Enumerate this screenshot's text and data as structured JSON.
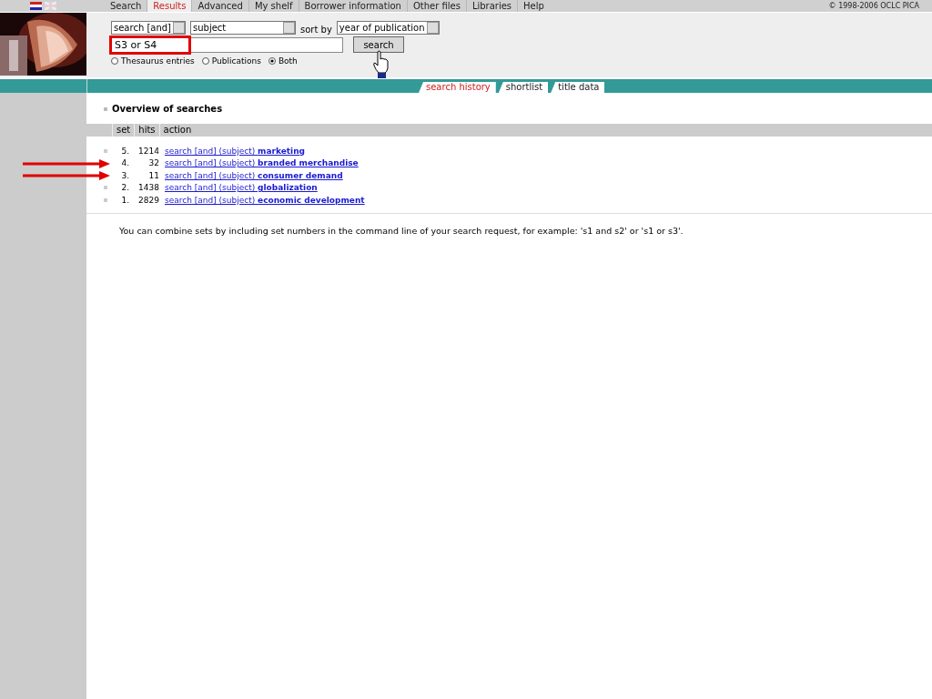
{
  "nav": {
    "items": [
      {
        "label": "Search",
        "selected": false
      },
      {
        "label": "Results",
        "selected": true
      },
      {
        "label": "Advanced",
        "selected": false
      },
      {
        "label": "My shelf",
        "selected": false
      },
      {
        "label": "Borrower information",
        "selected": false
      },
      {
        "label": "Other files",
        "selected": false
      },
      {
        "label": "Libraries",
        "selected": false
      },
      {
        "label": "Help",
        "selected": false
      }
    ],
    "copyright": "© 1998-2006 OCLC PICA"
  },
  "search_form": {
    "operator": "search [and]",
    "index": "subject",
    "sort_label": "sort by",
    "sort": "year of publication",
    "query": "S3 or S4",
    "query_highlighted": true,
    "button": "search",
    "scopes": [
      {
        "label": "Thesaurus entries",
        "selected": false
      },
      {
        "label": "Publications",
        "selected": false
      },
      {
        "label": "Both",
        "selected": true
      }
    ]
  },
  "tabs": [
    {
      "label": "search history",
      "selected": true
    },
    {
      "label": "shortlist",
      "selected": false
    },
    {
      "label": "title data",
      "selected": false
    }
  ],
  "heading": "Overview of searches",
  "table": {
    "columns": [
      "set",
      "hits",
      "action"
    ],
    "rows": [
      {
        "set": "5.",
        "hits": "1214",
        "action": "search [and] (subject) **marketing**",
        "highlighted": false
      },
      {
        "set": "4.",
        "hits": "32",
        "action": "search [and] (subject) **branded merchandise**",
        "highlighted": true
      },
      {
        "set": "3.",
        "hits": "11",
        "action": "search [and] (subject) **consumer demand**",
        "highlighted": true
      },
      {
        "set": "2.",
        "hits": "1438",
        "action": "search [and] (subject) **globalization**",
        "highlighted": false
      },
      {
        "set": "1.",
        "hits": "2829",
        "action": "search [and] (subject) **economic development**",
        "highlighted": false
      }
    ]
  },
  "note": "You can combine sets by including set numbers in the command line of your search request, for example: 's1 and s2' or 's1 or s3'."
}
